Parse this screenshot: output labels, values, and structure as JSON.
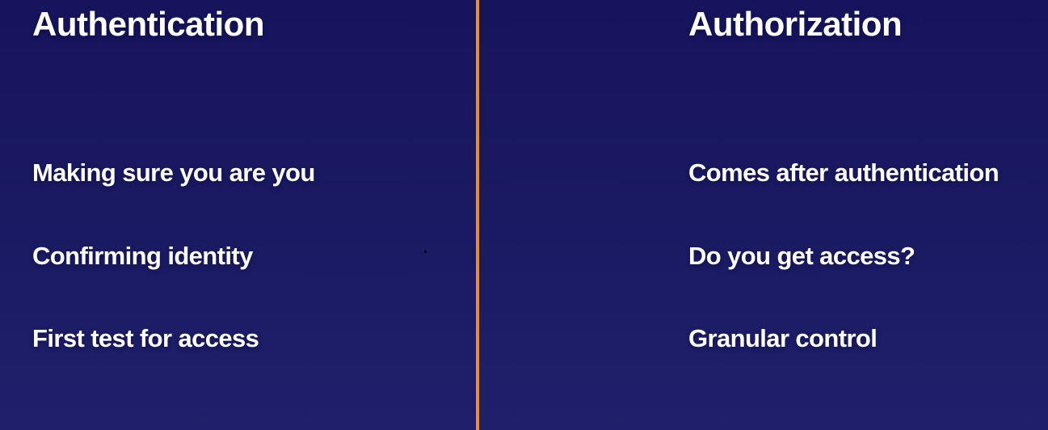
{
  "left": {
    "heading": "Authentication",
    "points": [
      "Making sure you are you",
      "Confirming identity",
      "First test for access"
    ]
  },
  "right": {
    "heading": "Authorization",
    "points": [
      "Comes after authentication",
      "Do you get access?",
      "Granular control"
    ]
  },
  "colors": {
    "background": "#1a1a63",
    "divider": "#f08a2a",
    "text": "#ffffff"
  }
}
